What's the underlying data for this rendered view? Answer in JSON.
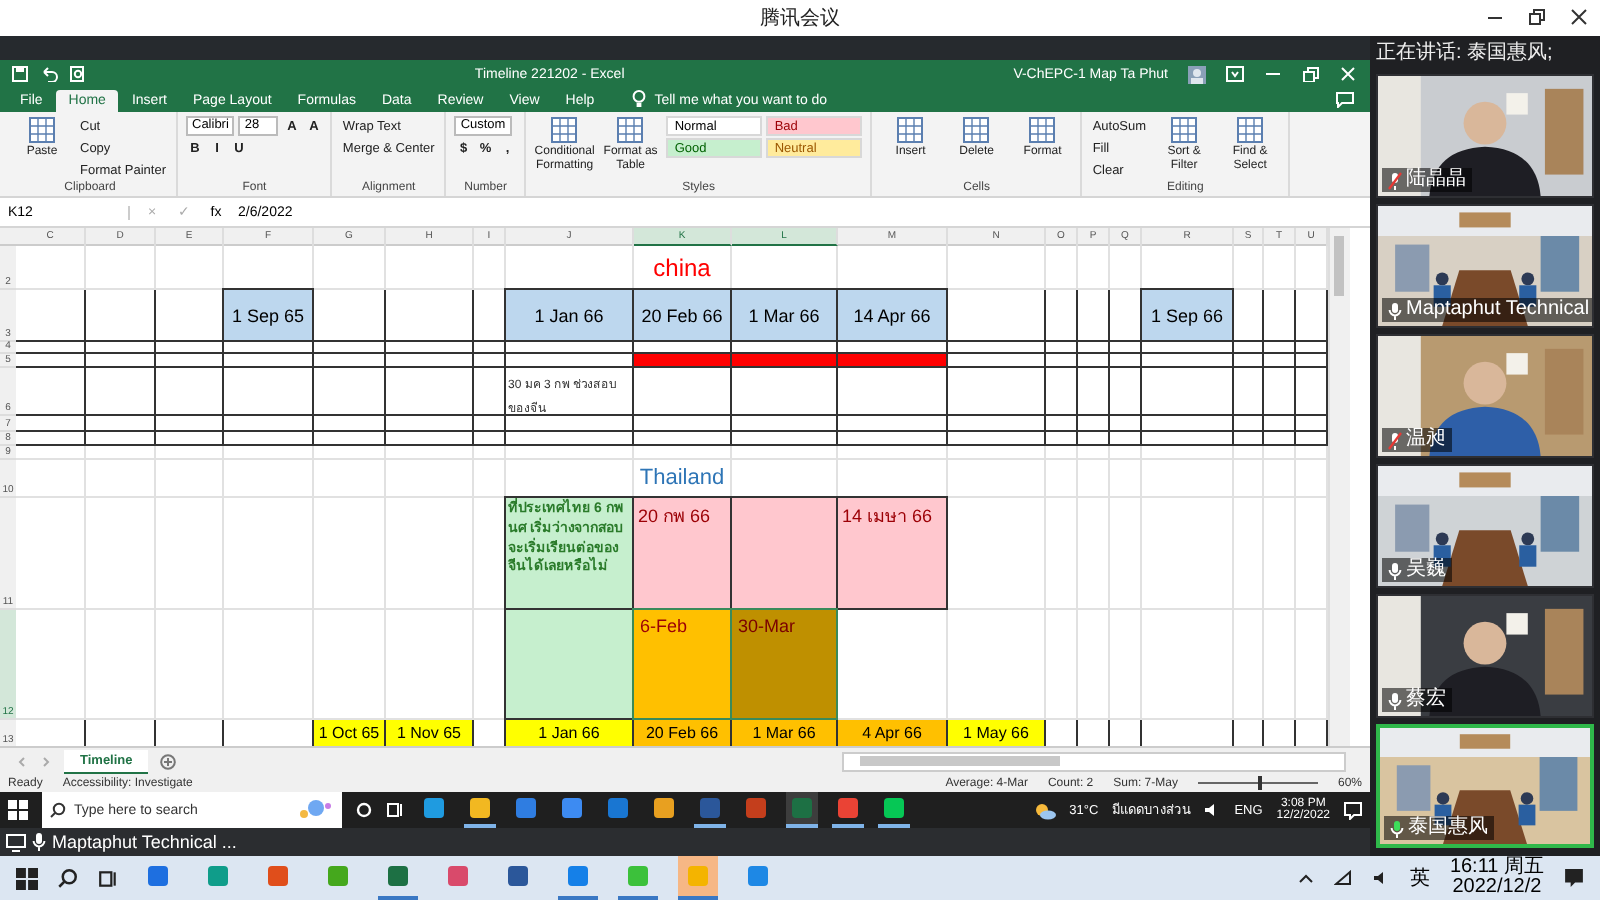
{
  "meeting": {
    "title": "腾讯会议",
    "speaking_label": "正在讲话: 泰国惠风;",
    "bar_title": "Maptaphut Technical ..."
  },
  "excel": {
    "title": "Timeline 221202  -  Excel",
    "account": "V-ChEPC-1 Map Ta Phut",
    "tabs": [
      {
        "label": "File",
        "selected": false
      },
      {
        "label": "Home",
        "selected": true
      },
      {
        "label": "Insert",
        "selected": false
      },
      {
        "label": "Page Layout",
        "selected": false
      },
      {
        "label": "Formulas",
        "selected": false
      },
      {
        "label": "Data",
        "selected": false
      },
      {
        "label": "Review",
        "selected": false
      },
      {
        "label": "View",
        "selected": false
      },
      {
        "label": "Help",
        "selected": false
      }
    ],
    "tell_me": "Tell me what you want to do",
    "ribbon": [
      {
        "label": "Clipboard",
        "parts": [
          {
            "kind": "large",
            "label": "Paste"
          },
          {
            "kind": "stack",
            "lines": [
              [
                {
                  "kind": "small",
                  "label": "Cut"
                }
              ],
              [
                {
                  "kind": "small",
                  "label": "Copy"
                }
              ],
              [
                {
                  "kind": "small",
                  "label": "Format Painter"
                }
              ]
            ]
          }
        ]
      },
      {
        "label": "Font",
        "parts": [
          {
            "kind": "stack",
            "lines": [
              [
                {
                  "kind": "field",
                  "label": "Calibri"
                },
                {
                  "kind": "field",
                  "label": "28"
                },
                {
                  "kind": "glyph",
                  "label": "A"
                },
                {
                  "kind": "glyph",
                  "label": "A"
                }
              ],
              [
                {
                  "kind": "glyph",
                  "label": "B"
                },
                {
                  "kind": "glyph",
                  "label": "I"
                },
                {
                  "kind": "glyph",
                  "label": "U"
                }
              ]
            ]
          }
        ]
      },
      {
        "label": "Alignment",
        "parts": [
          {
            "kind": "stack",
            "lines": [
              [
                {
                  "kind": "small",
                  "label": "Wrap Text"
                }
              ],
              [
                {
                  "kind": "small",
                  "label": "Merge & Center"
                }
              ]
            ]
          }
        ]
      },
      {
        "label": "Number",
        "parts": [
          {
            "kind": "stack",
            "lines": [
              [
                {
                  "kind": "field",
                  "label": "Custom"
                }
              ],
              [
                {
                  "kind": "glyph",
                  "label": "$"
                },
                {
                  "kind": "glyph",
                  "label": "%"
                },
                {
                  "kind": "glyph",
                  "label": ","
                }
              ]
            ]
          }
        ]
      },
      {
        "label": "Styles",
        "parts": [
          {
            "kind": "large",
            "label": "Conditional Formatting"
          },
          {
            "kind": "large",
            "label": "Format as Table"
          },
          {
            "kind": "stack",
            "lines": [
              [
                {
                  "kind": "chip-normal",
                  "label": "Normal"
                },
                {
                  "kind": "chip-bad",
                  "label": "Bad"
                }
              ],
              [
                {
                  "kind": "chip-good",
                  "label": "Good"
                },
                {
                  "kind": "chip-neutral",
                  "label": "Neutral"
                }
              ]
            ]
          }
        ]
      },
      {
        "label": "Cells",
        "parts": [
          {
            "kind": "large",
            "label": "Insert"
          },
          {
            "kind": "large",
            "label": "Delete"
          },
          {
            "kind": "large",
            "label": "Format"
          }
        ]
      },
      {
        "label": "Editing",
        "parts": [
          {
            "kind": "stack",
            "lines": [
              [
                {
                  "kind": "small",
                  "label": "AutoSum"
                }
              ],
              [
                {
                  "kind": "small",
                  "label": "Fill"
                }
              ],
              [
                {
                  "kind": "small",
                  "label": "Clear"
                }
              ]
            ]
          },
          {
            "kind": "large",
            "label": "Sort & Filter"
          },
          {
            "kind": "large",
            "label": "Find & Select"
          }
        ]
      }
    ],
    "name_box": "K12",
    "cancel": "×",
    "enter": "✓",
    "fx": "fx",
    "formula": "2/6/2022",
    "columns": [
      {
        "label": "C",
        "selected": false
      },
      {
        "label": "D",
        "selected": false
      },
      {
        "label": "E",
        "selected": false
      },
      {
        "label": "F",
        "selected": false
      },
      {
        "label": "G",
        "selected": false
      },
      {
        "label": "H",
        "selected": false
      },
      {
        "label": "I",
        "selected": false
      },
      {
        "label": "J",
        "selected": false
      },
      {
        "label": "K",
        "selected": true
      },
      {
        "label": "L",
        "selected": true
      },
      {
        "label": "M",
        "selected": false
      },
      {
        "label": "N",
        "selected": false
      },
      {
        "label": "O",
        "selected": false
      },
      {
        "label": "P",
        "selected": false
      },
      {
        "label": "Q",
        "selected": false
      },
      {
        "label": "R",
        "selected": false
      },
      {
        "label": "S",
        "selected": false
      },
      {
        "label": "T",
        "selected": false
      },
      {
        "label": "U",
        "selected": false
      }
    ],
    "rows": [
      {
        "number": "2",
        "selected": false,
        "boxed": false,
        "cells": [
          {
            "kind": "plain"
          },
          {
            "kind": "plain"
          },
          {
            "kind": "plain"
          },
          {
            "kind": "plain"
          },
          {
            "kind": "plain"
          },
          {
            "kind": "plain"
          },
          {
            "kind": "plain"
          },
          {
            "kind": "plain"
          },
          {
            "kind": "heading",
            "text": "china"
          },
          {
            "kind": "plain"
          },
          {
            "kind": "plain"
          },
          {
            "kind": "plain"
          },
          {
            "kind": "plain"
          },
          {
            "kind": "plain"
          },
          {
            "kind": "plain"
          },
          {
            "kind": "plain"
          },
          {
            "kind": "plain"
          },
          {
            "kind": "plain"
          },
          {
            "kind": "plain"
          }
        ]
      },
      {
        "number": "3",
        "selected": false,
        "boxed": true,
        "cells": [
          {
            "kind": "plain"
          },
          {
            "kind": "plain"
          },
          {
            "kind": "plain"
          },
          {
            "kind": "date",
            "text": "1 Sep 65"
          },
          {
            "kind": "plain"
          },
          {
            "kind": "plain"
          },
          {
            "kind": "plain"
          },
          {
            "kind": "date",
            "text": "1 Jan 66"
          },
          {
            "kind": "date",
            "text": "20 Feb 66"
          },
          {
            "kind": "date",
            "text": "1 Mar 66"
          },
          {
            "kind": "date",
            "text": "14 Apr 66"
          },
          {
            "kind": "plain"
          },
          {
            "kind": "plain"
          },
          {
            "kind": "plain"
          },
          {
            "kind": "plain"
          },
          {
            "kind": "date",
            "text": "1 Sep 66"
          },
          {
            "kind": "plain"
          },
          {
            "kind": "plain"
          },
          {
            "kind": "plain"
          }
        ]
      },
      {
        "number": "4",
        "selected": false,
        "boxed": true,
        "cells": [
          {
            "kind": "plain"
          },
          {
            "kind": "plain"
          },
          {
            "kind": "plain"
          },
          {
            "kind": "plain"
          },
          {
            "kind": "plain"
          },
          {
            "kind": "plain"
          },
          {
            "kind": "plain"
          },
          {
            "kind": "plain"
          },
          {
            "kind": "plain"
          },
          {
            "kind": "plain"
          },
          {
            "kind": "plain"
          },
          {
            "kind": "plain"
          },
          {
            "kind": "plain"
          },
          {
            "kind": "plain"
          },
          {
            "kind": "plain"
          },
          {
            "kind": "plain"
          },
          {
            "kind": "plain"
          },
          {
            "kind": "plain"
          },
          {
            "kind": "plain"
          }
        ]
      },
      {
        "number": "5",
        "selected": false,
        "boxed": true,
        "cells": [
          {
            "kind": "plain"
          },
          {
            "kind": "plain"
          },
          {
            "kind": "plain"
          },
          {
            "kind": "plain"
          },
          {
            "kind": "plain"
          },
          {
            "kind": "plain"
          },
          {
            "kind": "plain"
          },
          {
            "kind": "plain"
          },
          {
            "kind": "marker"
          },
          {
            "kind": "marker"
          },
          {
            "kind": "marker"
          },
          {
            "kind": "plain"
          },
          {
            "kind": "plain"
          },
          {
            "kind": "plain"
          },
          {
            "kind": "plain"
          },
          {
            "kind": "plain"
          },
          {
            "kind": "plain"
          },
          {
            "kind": "plain"
          },
          {
            "kind": "plain"
          }
        ]
      },
      {
        "number": "6",
        "selected": false,
        "boxed": true,
        "cells": [
          {
            "kind": "plain"
          },
          {
            "kind": "plain"
          },
          {
            "kind": "plain"
          },
          {
            "kind": "plain"
          },
          {
            "kind": "plain"
          },
          {
            "kind": "plain"
          },
          {
            "kind": "plain"
          },
          {
            "kind": "note",
            "text": "30 มค  3 กพ  ช่วงสอบของจีน"
          },
          {
            "kind": "plain"
          },
          {
            "kind": "plain"
          },
          {
            "kind": "plain"
          },
          {
            "kind": "plain"
          },
          {
            "kind": "plain"
          },
          {
            "kind": "plain"
          },
          {
            "kind": "plain"
          },
          {
            "kind": "plain"
          },
          {
            "kind": "plain"
          },
          {
            "kind": "plain"
          },
          {
            "kind": "plain"
          }
        ]
      },
      {
        "number": "7",
        "selected": false,
        "boxed": true,
        "cells": [
          {
            "kind": "plain"
          },
          {
            "kind": "plain"
          },
          {
            "kind": "plain"
          },
          {
            "kind": "plain"
          },
          {
            "kind": "plain"
          },
          {
            "kind": "plain"
          },
          {
            "kind": "plain"
          },
          {
            "kind": "plain"
          },
          {
            "kind": "plain"
          },
          {
            "kind": "plain"
          },
          {
            "kind": "plain"
          },
          {
            "kind": "plain"
          },
          {
            "kind": "plain"
          },
          {
            "kind": "plain"
          },
          {
            "kind": "plain"
          },
          {
            "kind": "plain"
          },
          {
            "kind": "plain"
          },
          {
            "kind": "plain"
          },
          {
            "kind": "plain"
          }
        ]
      },
      {
        "number": "8",
        "selected": false,
        "boxed": true,
        "cells": [
          {
            "kind": "plain"
          },
          {
            "kind": "plain"
          },
          {
            "kind": "plain"
          },
          {
            "kind": "plain"
          },
          {
            "kind": "plain"
          },
          {
            "kind": "plain"
          },
          {
            "kind": "plain"
          },
          {
            "kind": "plain"
          },
          {
            "kind": "plain"
          },
          {
            "kind": "plain"
          },
          {
            "kind": "plain"
          },
          {
            "kind": "plain"
          },
          {
            "kind": "plain"
          },
          {
            "kind": "plain"
          },
          {
            "kind": "plain"
          },
          {
            "kind": "plain"
          },
          {
            "kind": "plain"
          },
          {
            "kind": "plain"
          },
          {
            "kind": "plain"
          }
        ]
      },
      {
        "number": "9",
        "selected": false,
        "boxed": false,
        "cells": [
          {
            "kind": "plain"
          },
          {
            "kind": "plain"
          },
          {
            "kind": "plain"
          },
          {
            "kind": "plain"
          },
          {
            "kind": "plain"
          },
          {
            "kind": "plain"
          },
          {
            "kind": "plain"
          },
          {
            "kind": "plain"
          },
          {
            "kind": "plain"
          },
          {
            "kind": "plain"
          },
          {
            "kind": "plain"
          },
          {
            "kind": "plain"
          },
          {
            "kind": "plain"
          },
          {
            "kind": "plain"
          },
          {
            "kind": "plain"
          },
          {
            "kind": "plain"
          },
          {
            "kind": "plain"
          },
          {
            "kind": "plain"
          },
          {
            "kind": "plain"
          }
        ]
      },
      {
        "number": "10",
        "selected": false,
        "boxed": false,
        "cells": [
          {
            "kind": "plain"
          },
          {
            "kind": "plain"
          },
          {
            "kind": "plain"
          },
          {
            "kind": "plain"
          },
          {
            "kind": "plain"
          },
          {
            "kind": "plain"
          },
          {
            "kind": "plain"
          },
          {
            "kind": "plain"
          },
          {
            "kind": "subheading",
            "text": "Thailand"
          },
          {
            "kind": "plain"
          },
          {
            "kind": "plain"
          },
          {
            "kind": "plain"
          },
          {
            "kind": "plain"
          },
          {
            "kind": "plain"
          },
          {
            "kind": "plain"
          },
          {
            "kind": "plain"
          },
          {
            "kind": "plain"
          },
          {
            "kind": "plain"
          },
          {
            "kind": "plain"
          }
        ]
      },
      {
        "number": "11",
        "selected": false,
        "boxed": false,
        "cells": [
          {
            "kind": "plain"
          },
          {
            "kind": "plain"
          },
          {
            "kind": "plain"
          },
          {
            "kind": "plain"
          },
          {
            "kind": "plain"
          },
          {
            "kind": "plain"
          },
          {
            "kind": "plain"
          },
          {
            "kind": "proposal",
            "text": "ที่ประเทศไทย 6 กพ  นศ เริ่มว่างจากสอบ จะเริ่มเรียนต่อของจีนได้เลยหรือไม่"
          },
          {
            "kind": "thai-date",
            "text": "20 กพ 66"
          },
          {
            "kind": "thai-date"
          },
          {
            "kind": "thai-date",
            "text": "14 เมษา 66"
          },
          {
            "kind": "plain"
          },
          {
            "kind": "plain"
          },
          {
            "kind": "plain"
          },
          {
            "kind": "plain"
          },
          {
            "kind": "plain"
          },
          {
            "kind": "plain"
          },
          {
            "kind": "plain"
          },
          {
            "kind": "plain"
          }
        ]
      },
      {
        "number": "12",
        "selected": true,
        "boxed": false,
        "cells": [
          {
            "kind": "plain"
          },
          {
            "kind": "plain"
          },
          {
            "kind": "plain"
          },
          {
            "kind": "plain"
          },
          {
            "kind": "plain"
          },
          {
            "kind": "plain"
          },
          {
            "kind": "plain"
          },
          {
            "kind": "proposal"
          },
          {
            "kind": "feb",
            "text": "6-Feb"
          },
          {
            "kind": "mar",
            "text": "30-Mar"
          },
          {
            "kind": "plain"
          },
          {
            "kind": "plain"
          },
          {
            "kind": "plain"
          },
          {
            "kind": "plain"
          },
          {
            "kind": "plain"
          },
          {
            "kind": "plain"
          },
          {
            "kind": "plain"
          },
          {
            "kind": "plain"
          },
          {
            "kind": "plain"
          }
        ]
      },
      {
        "number": "13",
        "selected": false,
        "boxed": true,
        "cells": [
          {
            "kind": "plain"
          },
          {
            "kind": "plain"
          },
          {
            "kind": "plain"
          },
          {
            "kind": "plain"
          },
          {
            "kind": "timeline",
            "text": "1 Oct 65"
          },
          {
            "kind": "timeline",
            "text": "1 Nov 65"
          },
          {
            "kind": "plain"
          },
          {
            "kind": "timeline",
            "text": "1 Jan 66"
          },
          {
            "kind": "timeline-key",
            "text": "20 Feb 66"
          },
          {
            "kind": "timeline-key",
            "text": "1 Mar 66"
          },
          {
            "kind": "timeline-key",
            "text": "4 Apr 66"
          },
          {
            "kind": "timeline",
            "text": "1 May 66"
          },
          {
            "kind": "plain"
          },
          {
            "kind": "plain"
          },
          {
            "kind": "plain"
          },
          {
            "kind": "plain"
          },
          {
            "kind": "plain"
          },
          {
            "kind": "plain"
          },
          {
            "kind": "plain"
          }
        ]
      }
    ],
    "sheet_tabs": [
      {
        "label": "Timeline",
        "selected": true
      }
    ],
    "status": {
      "ready": "Ready",
      "accessibility": "Accessibility: Investigate",
      "average": "Average: 4-Mar",
      "count": "Count: 2",
      "sum": "Sum: 7-May",
      "zoom": "60%",
      "zoom_slider": {
        "level": 0.5
      }
    }
  },
  "taskbar": {
    "search_placeholder": "Type here to search",
    "apps": [
      {
        "running": false,
        "selected": false
      },
      {
        "running": true,
        "selected": false
      },
      {
        "running": false,
        "selected": false
      },
      {
        "running": false,
        "selected": false
      },
      {
        "running": false,
        "selected": false
      },
      {
        "running": false,
        "selected": false
      },
      {
        "running": true,
        "selected": false
      },
      {
        "running": false,
        "selected": false
      },
      {
        "running": true,
        "selected": true
      },
      {
        "running": true,
        "selected": false
      },
      {
        "running": true,
        "selected": false
      }
    ],
    "weather": "31°C",
    "weather_text": "มีแดดบางส่วน",
    "lang": "ENG",
    "time": "3:08 PM",
    "date": "12/2/2022"
  },
  "participants": [
    {
      "name": "陆晶晶",
      "muted": true,
      "speaking": false
    },
    {
      "name": "Maptaphut Technical",
      "muted": false,
      "speaking": false
    },
    {
      "name": "温昶",
      "muted": true,
      "speaking": false
    },
    {
      "name": "吴巍",
      "muted": false,
      "speaking": false
    },
    {
      "name": "蔡宏",
      "muted": false,
      "speaking": false
    },
    {
      "name": "泰国惠风",
      "muted": false,
      "speaking": true
    }
  ],
  "outer_taskbar": {
    "apps": [
      {
        "running": false,
        "selected": false
      },
      {
        "running": false,
        "selected": false
      },
      {
        "running": false,
        "selected": false
      },
      {
        "running": false,
        "selected": false
      },
      {
        "running": true,
        "selected": false
      },
      {
        "running": false,
        "selected": false
      },
      {
        "running": false,
        "selected": false
      },
      {
        "running": true,
        "selected": false
      },
      {
        "running": true,
        "selected": false
      },
      {
        "running": true,
        "selected": true
      },
      {
        "running": false,
        "selected": false
      }
    ],
    "ime": "英",
    "time": "16:11 周五",
    "date": "2022/12/2"
  }
}
